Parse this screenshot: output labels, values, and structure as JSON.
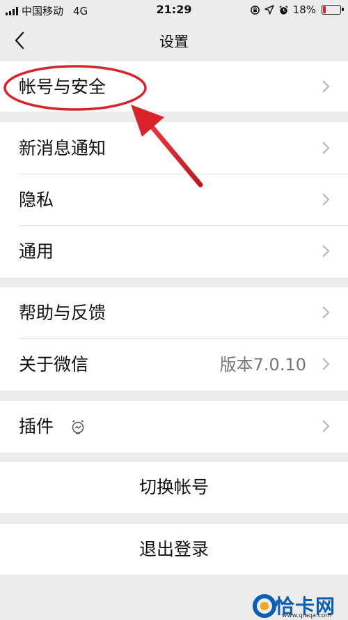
{
  "status_bar": {
    "carrier": "中国移动",
    "network": "4G",
    "time": "21:29",
    "battery_percent": "18%",
    "battery_level": 0.18,
    "icons": [
      "lock-rotation-icon",
      "location-icon",
      "alarm-icon"
    ]
  },
  "nav": {
    "title": "设置",
    "back_icon": "chevron-left-icon"
  },
  "settings": {
    "account_security": "帐号与安全",
    "new_message_notification": "新消息通知",
    "privacy": "隐私",
    "general": "通用",
    "help_feedback": "帮助与反馈",
    "about_wechat": "关于微信",
    "version": "版本7.0.10",
    "plugins": "插件",
    "plugins_icon": "plugin-alarm-icon"
  },
  "actions": {
    "switch_account": "切换帐号",
    "log_out": "退出登录"
  },
  "annotation": {
    "highlight_color": "#d8232a",
    "target": "account_security"
  },
  "watermark": {
    "text": "恰卡网",
    "sub": "www.qiaqa.com"
  }
}
